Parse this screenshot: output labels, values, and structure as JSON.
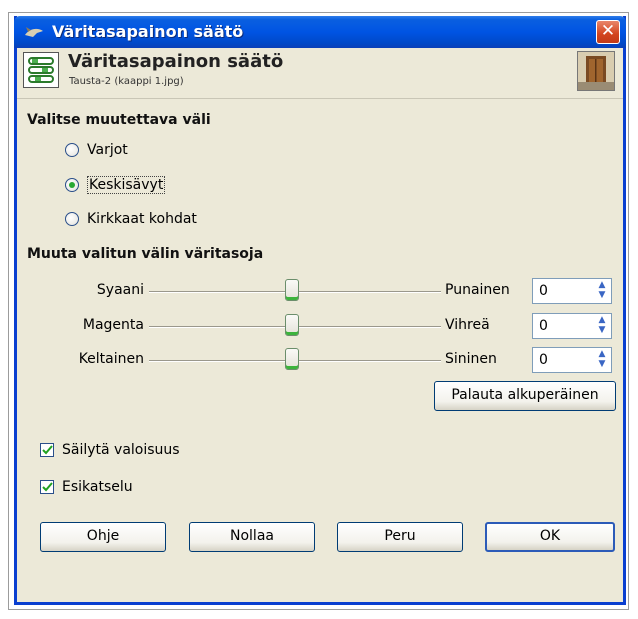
{
  "window": {
    "title": "Väritasapainon säätö",
    "close_label": "✕"
  },
  "header": {
    "title": "Väritasapainon säätö",
    "subtitle": "Tausta-2 (kaappi 1.jpg)"
  },
  "range_section": {
    "title": "Valitse muutettava väli",
    "options": [
      {
        "label": "Varjot",
        "checked": false
      },
      {
        "label": "Keskisävyt",
        "checked": true
      },
      {
        "label": "Kirkkaat kohdat",
        "checked": false
      }
    ]
  },
  "levels_section": {
    "title": "Muuta valitun välin väritasoja",
    "sliders": [
      {
        "left": "Syaani",
        "right": "Punainen",
        "value": "0",
        "position": 0.5
      },
      {
        "left": "Magenta",
        "right": "Vihreä",
        "value": "0",
        "position": 0.5
      },
      {
        "left": "Keltainen",
        "right": "Sininen",
        "value": "0",
        "position": 0.5
      }
    ],
    "reset_button": "Palauta alkuperäinen"
  },
  "options": {
    "preserve_luminosity": {
      "label": "Säilytä valoisuus",
      "checked": true
    },
    "preview": {
      "label": "Esikatselu",
      "checked": true
    }
  },
  "buttons": {
    "help": "Ohje",
    "reset": "Nollaa",
    "cancel": "Peru",
    "ok": "OK"
  },
  "colors": {
    "titlebar": "#0054e3",
    "dialog_bg": "#ece9d8",
    "accent_green": "#27a832"
  }
}
